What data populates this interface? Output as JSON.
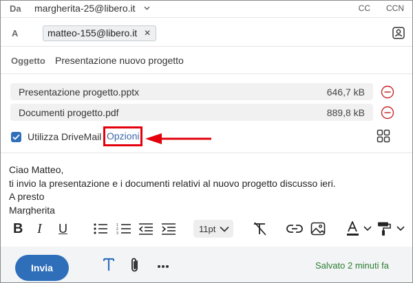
{
  "header": {
    "from_label": "Da",
    "from_address": "margherita-25@libero.it",
    "cc_label": "CC",
    "ccn_label": "CCN",
    "to_label": "A",
    "to_recipient": "matteo-155@libero.it",
    "subject_label": "Oggetto",
    "subject_value": "Presentazione nuovo progetto"
  },
  "attachments": [
    {
      "name": "Presentazione progetto.pptx",
      "size": "646,7 kB"
    },
    {
      "name": "Documenti progetto.pdf",
      "size": "889,8 kB"
    }
  ],
  "drivemail": {
    "checkbox_label": "Utilizza DriveMail",
    "checked": true,
    "options_link": "Opzioni"
  },
  "body": {
    "lines": [
      "Ciao Matteo,",
      "ti invio la presentazione e i documenti relativi al nuovo progetto discusso ieri.",
      "A presto",
      "Margherita"
    ]
  },
  "format_toolbar": {
    "bold": "B",
    "italic": "I",
    "underline": "U",
    "font_size": "11pt"
  },
  "bottom_bar": {
    "send_label": "Invia",
    "saved_status": "Salvato 2 minuti fa"
  },
  "colors": {
    "accent": "#2f6fba",
    "annotation": "#e3000b",
    "remove": "#c62828",
    "saved": "#2e7d32"
  },
  "icons": [
    "chevron-down-icon",
    "close-icon",
    "contact-card-icon",
    "remove-circle-icon",
    "checkbox-icon",
    "apps-grid-icon",
    "bullet-list-icon",
    "numbered-list-icon",
    "outdent-icon",
    "indent-icon",
    "clear-format-icon",
    "link-icon",
    "image-icon",
    "font-color-icon",
    "paint-format-icon",
    "text-format-icon",
    "paperclip-icon",
    "more-icon"
  ]
}
